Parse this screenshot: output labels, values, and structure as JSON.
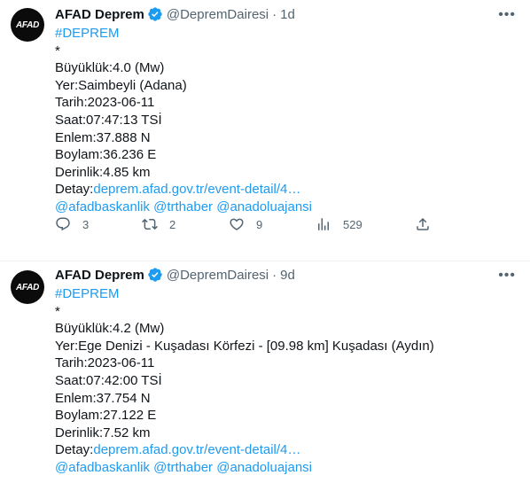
{
  "tweets": [
    {
      "avatar_text": "AFAD",
      "name": "AFAD Deprem",
      "handle": "@DepremDairesi",
      "time": "1d",
      "hashtag": "#DEPREM",
      "star": "*",
      "lines": [
        "Büyüklük:4.0 (Mw)",
        "Yer:Saimbeyli (Adana)",
        "Tarih:2023-06-11",
        "Saat:07:47:13 TSİ",
        "Enlem:37.888 N",
        "Boylam:36.236 E",
        "Derinlik:4.85 km"
      ],
      "detail_label": "Detay:",
      "detail_link": "deprem.afad.gov.tr/event-detail/4…",
      "mentions": "@afadbaskanlik @trthaber @anadoluajansi",
      "replies": "3",
      "retweets": "2",
      "likes": "9",
      "views": "529"
    },
    {
      "avatar_text": "AFAD",
      "name": "AFAD Deprem",
      "handle": "@DepremDairesi",
      "time": "9d",
      "hashtag": "#DEPREM",
      "star": "*",
      "lines": [
        "Büyüklük:4.2 (Mw)",
        "Yer:Ege Denizi - Kuşadası Körfezi - [09.98 km] Kuşadası (Aydın)",
        "Tarih:2023-06-11",
        "Saat:07:42:00 TSİ",
        "Enlem:37.754 N",
        "Boylam:27.122 E",
        "Derinlik:7.52 km"
      ],
      "detail_label": "Detay:",
      "detail_link": "deprem.afad.gov.tr/event-detail/4…",
      "mentions": "@afadbaskanlik @trthaber @anadoluajansi"
    }
  ],
  "icons": {
    "verified": "verified-badge-icon",
    "more": "more-icon",
    "reply": "reply-icon",
    "retweet": "retweet-icon",
    "like": "heart-icon",
    "views": "views-icon",
    "share": "share-icon"
  },
  "colors": {
    "link": "#1d9bf0",
    "text": "#0f1419",
    "muted": "#536471",
    "avatar_bg": "#0b0b0b"
  }
}
